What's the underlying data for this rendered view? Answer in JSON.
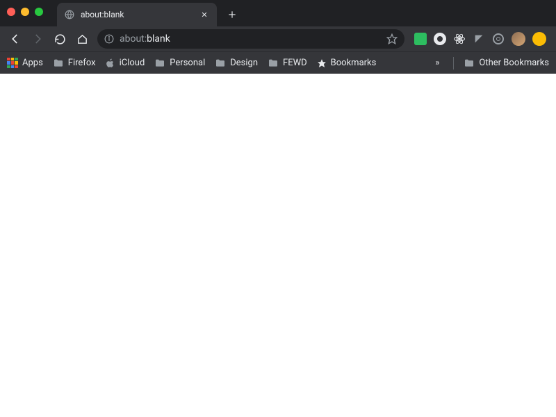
{
  "window": {
    "traffic_lights": {
      "close": "close",
      "minimize": "minimize",
      "maximize": "maximize"
    }
  },
  "tab": {
    "title": "about:blank"
  },
  "omnibox": {
    "url_prefix": "about:",
    "url_suffix": "blank"
  },
  "extensions": {
    "evernote": "Evernote",
    "circle": "Extension",
    "atom": "React DevTools",
    "arrow": "Extension",
    "target": "Extension",
    "avatar": "Account",
    "profile": "Profile"
  },
  "bookmarks": {
    "apps": "Apps",
    "items": [
      {
        "label": "Firefox"
      },
      {
        "label": "iCloud"
      },
      {
        "label": "Personal"
      },
      {
        "label": "Design"
      },
      {
        "label": "FEWD"
      },
      {
        "label": "Bookmarks"
      }
    ],
    "overflow": "»",
    "other": "Other Bookmarks"
  }
}
